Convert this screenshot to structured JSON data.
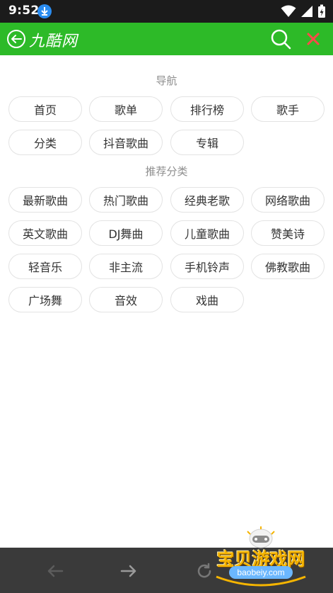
{
  "status_bar": {
    "time": "9:52"
  },
  "header": {
    "title": "九酷网"
  },
  "sections": [
    {
      "title": "导航",
      "items": [
        "首页",
        "歌单",
        "排行榜",
        "歌手",
        "分类",
        "抖音歌曲",
        "专辑"
      ]
    },
    {
      "title": "推荐分类",
      "items": [
        "最新歌曲",
        "热门歌曲",
        "经典老歌",
        "网络歌曲",
        "英文歌曲",
        "DJ舞曲",
        "儿童歌曲",
        "赞美诗",
        "轻音乐",
        "非主流",
        "手机铃声",
        "佛教歌曲",
        "广场舞",
        "音效",
        "戏曲"
      ]
    }
  ],
  "watermark": {
    "text": "宝贝游戏网",
    "domain": "baobeiy.com"
  },
  "colors": {
    "header": "#2dba28",
    "close": "#ff4a4a",
    "status_bar": "#1b1b1b",
    "bottom_bar": "#3a3a3a"
  }
}
